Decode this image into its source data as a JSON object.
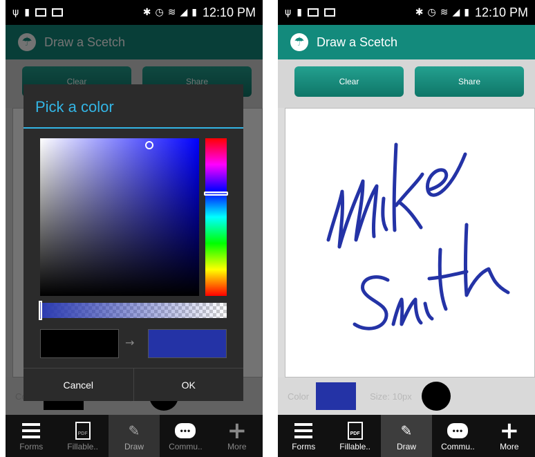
{
  "status_bar": {
    "time": "12:10 PM"
  },
  "app": {
    "title": "Draw a Scetch"
  },
  "toolbar": {
    "clear_label": "Clear",
    "share_label": "Share"
  },
  "bottom_bar": {
    "color_label": "Color",
    "size_label": "Size: 10px",
    "selected_color": "#2433a6"
  },
  "dialog": {
    "title": "Pick a color",
    "cancel_label": "Cancel",
    "ok_label": "OK",
    "old_color": "#000000",
    "new_color": "#2433a6",
    "arrow": "→"
  },
  "nav": {
    "tabs": [
      {
        "label": "Forms",
        "icon": "list-icon"
      },
      {
        "label": "Fillable..",
        "icon": "pdf-icon",
        "icon_text": "PDF"
      },
      {
        "label": "Draw",
        "icon": "pen-icon",
        "active": true
      },
      {
        "label": "Commu..",
        "icon": "chat-icon"
      },
      {
        "label": "More",
        "icon": "plus-icon"
      }
    ]
  },
  "colors": {
    "accent": "#138a7c",
    "dialog_accent": "#33b5e5",
    "ink": "#2433a6"
  }
}
